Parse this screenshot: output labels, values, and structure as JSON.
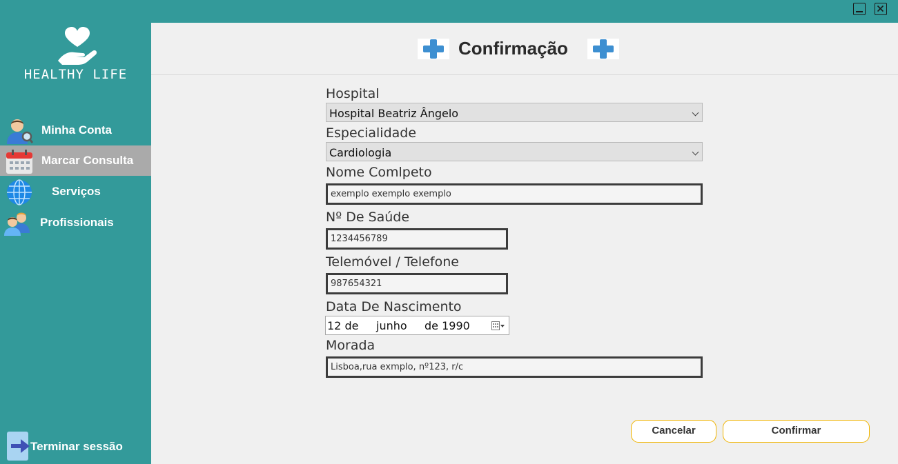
{
  "app": {
    "name": "Healthy Life"
  },
  "window": {
    "minimize_icon": "minimize-icon",
    "close_icon": "close-icon"
  },
  "sidebar": {
    "items": [
      {
        "label": "Minha Conta",
        "icon": "account-search-icon"
      },
      {
        "label": "Marcar Consulta",
        "icon": "calendar-icon",
        "active": true
      },
      {
        "label": "Serviços",
        "icon": "globe-icon"
      },
      {
        "label": "Profissionais",
        "icon": "professionals-icon"
      }
    ],
    "logout_label": "Terminar sessão"
  },
  "header": {
    "title": "Confirmação"
  },
  "form": {
    "hospital_label": "Hospital",
    "hospital_value": "Hospital Beatriz Ângelo",
    "specialty_label": "Especialidade",
    "specialty_value": "Cardiologia",
    "name_label": "Nome Comlpeto",
    "name_value": "exemplo exemplo exemplo",
    "health_number_label": "Nº De Saúde",
    "health_number_value": "1234456789",
    "phone_label": "Telemóvel / Telefone",
    "phone_value": "987654321",
    "birth_label": "Data De Nascimento",
    "birth_day": "12 de",
    "birth_month": "junho",
    "birth_year": "de 1990",
    "address_label": "Morada",
    "address_value": "Lisboa,rua exmplo, nº123, r/c"
  },
  "buttons": {
    "cancel": "Cancelar",
    "confirm": "Confirmar"
  },
  "colors": {
    "sidebar": "#339a9a",
    "active_item": "#aaaaaa",
    "button_border": "#f0b400",
    "plus": "#3d8fd1"
  }
}
